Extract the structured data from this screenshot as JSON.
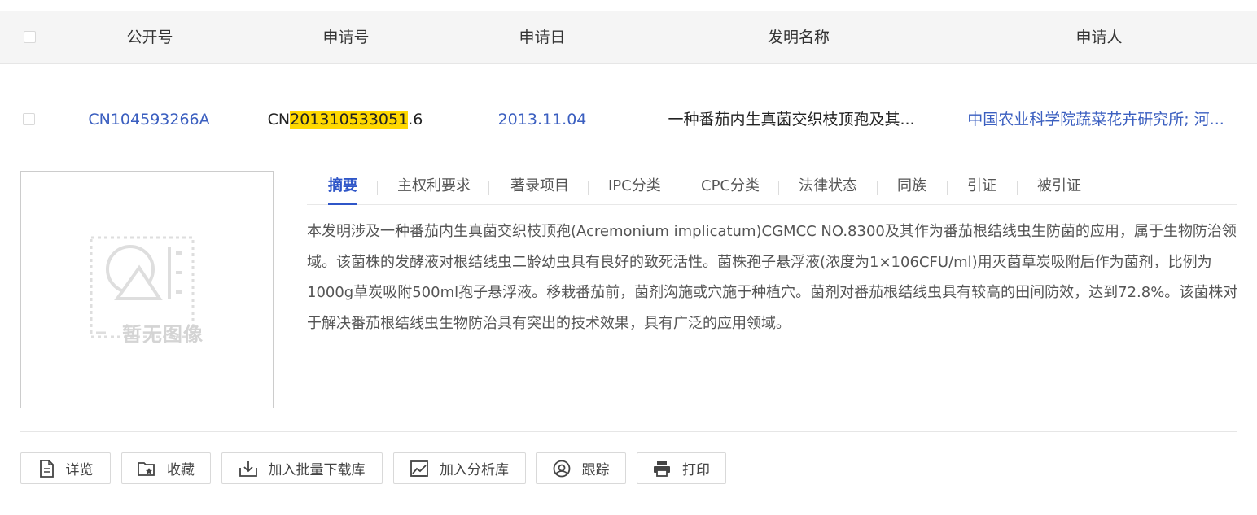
{
  "header": {
    "col_pub_no": "公开号",
    "col_app_no": "申请号",
    "col_app_date": "申请日",
    "col_title": "发明名称",
    "col_applicant": "申请人"
  },
  "record": {
    "pub_no": "CN104593266A",
    "app_no_prefix": "CN",
    "app_no_highlight": "201310533051",
    "app_no_suffix": ".6",
    "app_date": "2013.11.04",
    "title": "一种番茄内生真菌交织枝顶孢及其...",
    "applicant": "中国农业科学院蔬菜花卉研究所; 河...",
    "no_image_text": "暂无图像"
  },
  "tabs": [
    {
      "label": "摘要",
      "active": true
    },
    {
      "label": "主权利要求",
      "active": false
    },
    {
      "label": "著录项目",
      "active": false
    },
    {
      "label": "IPC分类",
      "active": false
    },
    {
      "label": "CPC分类",
      "active": false
    },
    {
      "label": "法律状态",
      "active": false
    },
    {
      "label": "同族",
      "active": false
    },
    {
      "label": "引证",
      "active": false
    },
    {
      "label": "被引证",
      "active": false
    }
  ],
  "abstract": "本发明涉及一种番茄内生真菌交织枝顶孢(Acremonium implicatum)CGMCC NO.8300及其作为番茄根结线虫生防菌的应用，属于生物防治领域。该菌株的发酵液对根结线虫二龄幼虫具有良好的致死活性。菌株孢子悬浮液(浓度为1×106CFU/ml)用灭菌草炭吸附后作为菌剂，比例为1000g草炭吸附500ml孢子悬浮液。移栽番茄前，菌剂沟施或穴施于种植穴。菌剂对番茄根结线虫具有较高的田间防效，达到72.8%。该菌株对于解决番茄根结线虫生物防治具有突出的技术效果，具有广泛的应用领域。",
  "actions": {
    "detail": "详览",
    "favorite": "收藏",
    "batch_download": "加入批量下载库",
    "analysis": "加入分析库",
    "track": "跟踪",
    "print": "打印"
  },
  "colors": {
    "link": "#3b5fc0",
    "active_tab": "#2f56c8",
    "highlight": "#ffd800",
    "header_bg": "#f5f5f5"
  }
}
